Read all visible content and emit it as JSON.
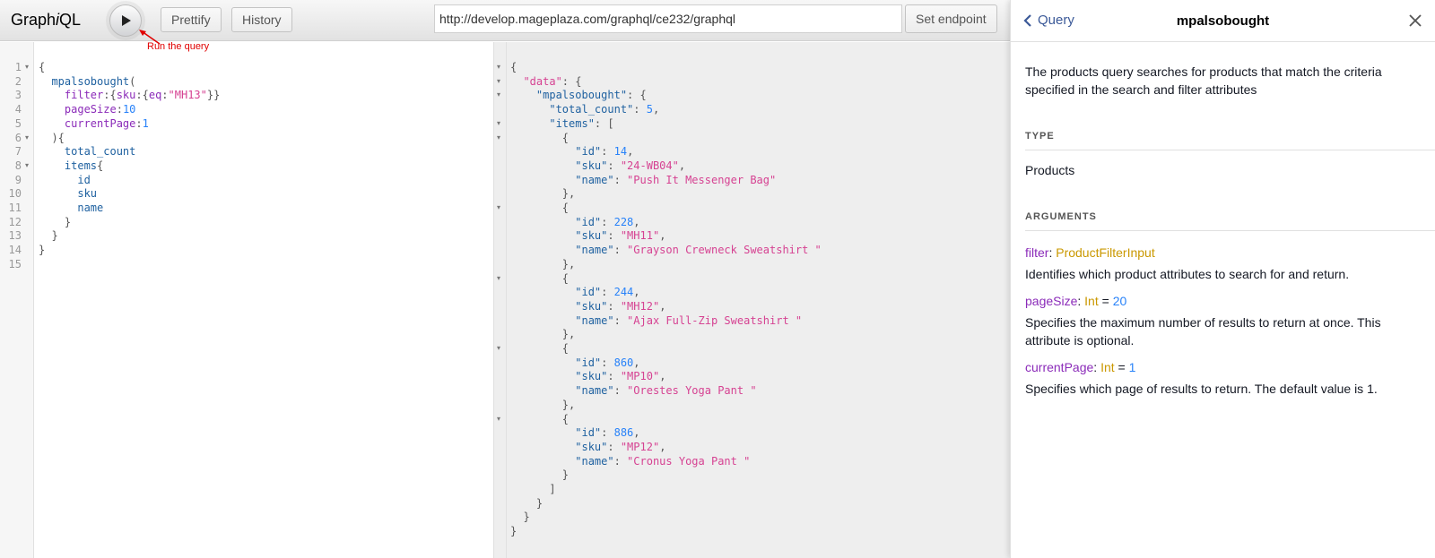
{
  "app": {
    "logo_prefix": "Graph",
    "logo_italic": "i",
    "logo_suffix": "QL"
  },
  "toolbar": {
    "prettify_label": "Prettify",
    "history_label": "History",
    "endpoint_value": "http://develop.mageplaza.com/graphql/ce232/graphql",
    "set_endpoint_label": "Set endpoint",
    "run_annotation": "Run the query"
  },
  "query": {
    "line_numbers": [
      "1",
      "2",
      "3",
      "4",
      "5",
      "6",
      "7",
      "8",
      "9",
      "10",
      "11",
      "12",
      "13",
      "14",
      "15"
    ],
    "lines": [
      [
        {
          "t": "{",
          "c": "punct"
        }
      ],
      [
        {
          "t": "  mpalsobought",
          "c": "def"
        },
        {
          "t": "(",
          "c": "punct"
        }
      ],
      [
        {
          "t": "    filter",
          "c": "attr"
        },
        {
          "t": ":{",
          "c": "punct"
        },
        {
          "t": "sku",
          "c": "attr"
        },
        {
          "t": ":{",
          "c": "punct"
        },
        {
          "t": "eq",
          "c": "attr"
        },
        {
          "t": ":",
          "c": "punct"
        },
        {
          "t": "\"MH13\"",
          "c": "str"
        },
        {
          "t": "}}",
          "c": "punct"
        }
      ],
      [
        {
          "t": "    pageSize",
          "c": "attr"
        },
        {
          "t": ":",
          "c": "punct"
        },
        {
          "t": "10",
          "c": "num"
        }
      ],
      [
        {
          "t": "    currentPage",
          "c": "attr"
        },
        {
          "t": ":",
          "c": "punct"
        },
        {
          "t": "1",
          "c": "num"
        }
      ],
      [
        {
          "t": "  ){",
          "c": "punct"
        }
      ],
      [
        {
          "t": "    total_count",
          "c": "field"
        }
      ],
      [
        {
          "t": "    items",
          "c": "field"
        },
        {
          "t": "{",
          "c": "punct"
        }
      ],
      [
        {
          "t": "      id",
          "c": "field"
        }
      ],
      [
        {
          "t": "      sku",
          "c": "field"
        }
      ],
      [
        {
          "t": "      name",
          "c": "field"
        }
      ],
      [
        {
          "t": "    }",
          "c": "punct"
        }
      ],
      [
        {
          "t": "  }",
          "c": "punct"
        }
      ],
      [
        {
          "t": "}",
          "c": "punct"
        }
      ],
      []
    ]
  },
  "result": {
    "lines": [
      [
        {
          "t": "{",
          "c": "punct"
        }
      ],
      [
        {
          "t": "  \"data\"",
          "c": "str"
        },
        {
          "t": ": {",
          "c": "punct"
        }
      ],
      [
        {
          "t": "    \"mpalsobought\"",
          "c": "def"
        },
        {
          "t": ": {",
          "c": "punct"
        }
      ],
      [
        {
          "t": "      \"total_count\"",
          "c": "def"
        },
        {
          "t": ": ",
          "c": "punct"
        },
        {
          "t": "5",
          "c": "num"
        },
        {
          "t": ",",
          "c": "punct"
        }
      ],
      [
        {
          "t": "      \"items\"",
          "c": "def"
        },
        {
          "t": ": [",
          "c": "punct"
        }
      ],
      [
        {
          "t": "        {",
          "c": "punct"
        }
      ],
      [
        {
          "t": "          \"id\"",
          "c": "def"
        },
        {
          "t": ": ",
          "c": "punct"
        },
        {
          "t": "14",
          "c": "num"
        },
        {
          "t": ",",
          "c": "punct"
        }
      ],
      [
        {
          "t": "          \"sku\"",
          "c": "def"
        },
        {
          "t": ": ",
          "c": "punct"
        },
        {
          "t": "\"24-WB04\"",
          "c": "str"
        },
        {
          "t": ",",
          "c": "punct"
        }
      ],
      [
        {
          "t": "          \"name\"",
          "c": "def"
        },
        {
          "t": ": ",
          "c": "punct"
        },
        {
          "t": "\"Push It Messenger Bag\"",
          "c": "str"
        }
      ],
      [
        {
          "t": "        },",
          "c": "punct"
        }
      ],
      [
        {
          "t": "        {",
          "c": "punct"
        }
      ],
      [
        {
          "t": "          \"id\"",
          "c": "def"
        },
        {
          "t": ": ",
          "c": "punct"
        },
        {
          "t": "228",
          "c": "num"
        },
        {
          "t": ",",
          "c": "punct"
        }
      ],
      [
        {
          "t": "          \"sku\"",
          "c": "def"
        },
        {
          "t": ": ",
          "c": "punct"
        },
        {
          "t": "\"MH11\"",
          "c": "str"
        },
        {
          "t": ",",
          "c": "punct"
        }
      ],
      [
        {
          "t": "          \"name\"",
          "c": "def"
        },
        {
          "t": ": ",
          "c": "punct"
        },
        {
          "t": "\"Grayson Crewneck Sweatshirt \"",
          "c": "str"
        }
      ],
      [
        {
          "t": "        },",
          "c": "punct"
        }
      ],
      [
        {
          "t": "        {",
          "c": "punct"
        }
      ],
      [
        {
          "t": "          \"id\"",
          "c": "def"
        },
        {
          "t": ": ",
          "c": "punct"
        },
        {
          "t": "244",
          "c": "num"
        },
        {
          "t": ",",
          "c": "punct"
        }
      ],
      [
        {
          "t": "          \"sku\"",
          "c": "def"
        },
        {
          "t": ": ",
          "c": "punct"
        },
        {
          "t": "\"MH12\"",
          "c": "str"
        },
        {
          "t": ",",
          "c": "punct"
        }
      ],
      [
        {
          "t": "          \"name\"",
          "c": "def"
        },
        {
          "t": ": ",
          "c": "punct"
        },
        {
          "t": "\"Ajax Full-Zip Sweatshirt \"",
          "c": "str"
        }
      ],
      [
        {
          "t": "        },",
          "c": "punct"
        }
      ],
      [
        {
          "t": "        {",
          "c": "punct"
        }
      ],
      [
        {
          "t": "          \"id\"",
          "c": "def"
        },
        {
          "t": ": ",
          "c": "punct"
        },
        {
          "t": "860",
          "c": "num"
        },
        {
          "t": ",",
          "c": "punct"
        }
      ],
      [
        {
          "t": "          \"sku\"",
          "c": "def"
        },
        {
          "t": ": ",
          "c": "punct"
        },
        {
          "t": "\"MP10\"",
          "c": "str"
        },
        {
          "t": ",",
          "c": "punct"
        }
      ],
      [
        {
          "t": "          \"name\"",
          "c": "def"
        },
        {
          "t": ": ",
          "c": "punct"
        },
        {
          "t": "\"Orestes Yoga Pant \"",
          "c": "str"
        }
      ],
      [
        {
          "t": "        },",
          "c": "punct"
        }
      ],
      [
        {
          "t": "        {",
          "c": "punct"
        }
      ],
      [
        {
          "t": "          \"id\"",
          "c": "def"
        },
        {
          "t": ": ",
          "c": "punct"
        },
        {
          "t": "886",
          "c": "num"
        },
        {
          "t": ",",
          "c": "punct"
        }
      ],
      [
        {
          "t": "          \"sku\"",
          "c": "def"
        },
        {
          "t": ": ",
          "c": "punct"
        },
        {
          "t": "\"MP12\"",
          "c": "str"
        },
        {
          "t": ",",
          "c": "punct"
        }
      ],
      [
        {
          "t": "          \"name\"",
          "c": "def"
        },
        {
          "t": ": ",
          "c": "punct"
        },
        {
          "t": "\"Cronus Yoga Pant \"",
          "c": "str"
        }
      ],
      [
        {
          "t": "        }",
          "c": "punct"
        }
      ],
      [
        {
          "t": "      ]",
          "c": "punct"
        }
      ],
      [
        {
          "t": "    }",
          "c": "punct"
        }
      ],
      [
        {
          "t": "  }",
          "c": "punct"
        }
      ],
      [
        {
          "t": "}",
          "c": "punct"
        }
      ]
    ]
  },
  "docs": {
    "back_label": "Query",
    "title": "mpalsobought",
    "description": "The products query searches for products that match the criteria specified in the search and filter attributes",
    "type_heading": "TYPE",
    "type_name": "Products",
    "arguments_heading": "ARGUMENTS",
    "arguments": [
      {
        "name": "filter",
        "sep": ": ",
        "type": "ProductFilterInput",
        "eq": "",
        "default": "",
        "desc": "Identifies which product attributes to search for and return."
      },
      {
        "name": "pageSize",
        "sep": ": ",
        "type": "Int",
        "eq": " = ",
        "default": "20",
        "desc": "Specifies the maximum number of results to return at once. This attribute is optional."
      },
      {
        "name": "currentPage",
        "sep": ": ",
        "type": "Int",
        "eq": " = ",
        "default": "1",
        "desc": "Specifies which page of results to return. The default value is 1."
      }
    ]
  },
  "colors": {
    "accent_link": "#3b5998",
    "type_color": "#ca9800",
    "arg_color": "#8b2bb9",
    "number_color": "#2882f9",
    "string_color": "#d64292",
    "annotation_color": "#e00000"
  }
}
